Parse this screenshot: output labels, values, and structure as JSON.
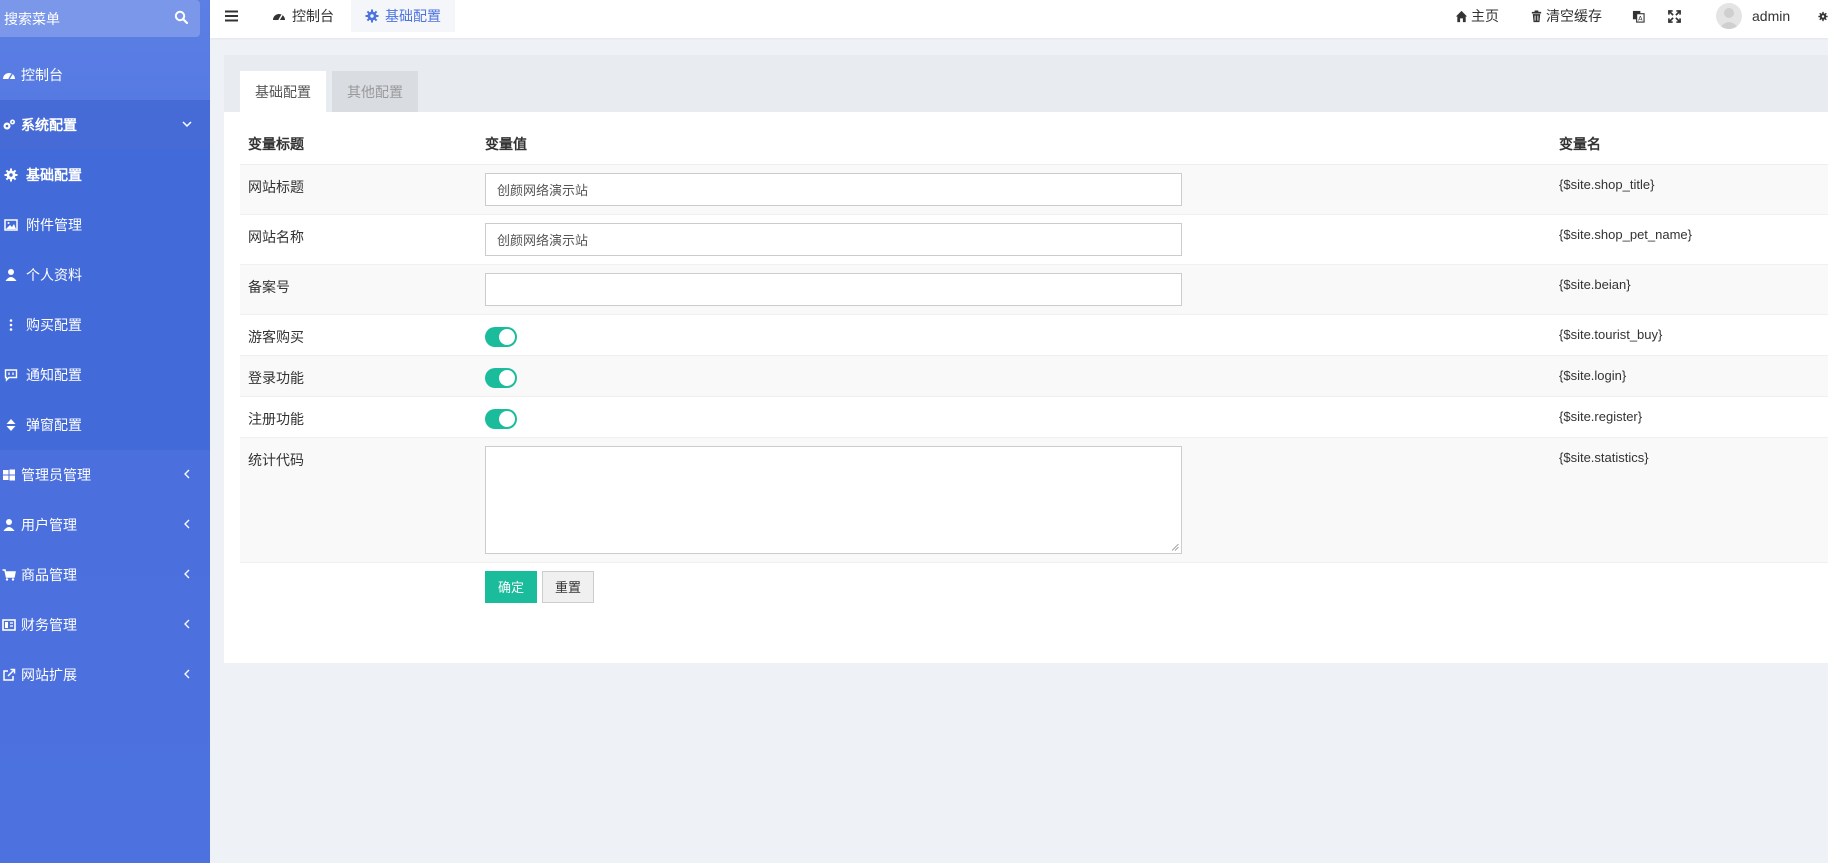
{
  "sidebar": {
    "search_placeholder": "搜索菜单",
    "items": [
      {
        "label": "控制台"
      },
      {
        "label": "系统配置"
      },
      {
        "label": "管理员管理"
      },
      {
        "label": "用户管理"
      },
      {
        "label": "商品管理"
      },
      {
        "label": "财务管理"
      },
      {
        "label": "网站扩展"
      }
    ],
    "submenu": [
      {
        "label": "基础配置"
      },
      {
        "label": "附件管理"
      },
      {
        "label": "个人资料"
      },
      {
        "label": "购买配置"
      },
      {
        "label": "通知配置"
      },
      {
        "label": "弹窗配置"
      }
    ]
  },
  "topnav": {
    "tabs": [
      {
        "label": "控制台"
      },
      {
        "label": "基础配置"
      }
    ],
    "home": "主页",
    "clear_cache": "清空缓存",
    "user": "admin"
  },
  "panel": {
    "tabs": [
      {
        "label": "基础配置"
      },
      {
        "label": "其他配置"
      }
    ],
    "columns": {
      "title": "变量标题",
      "value": "变量值",
      "name": "变量名"
    },
    "rows": {
      "site_title": {
        "label": "网站标题",
        "value": "创颜网络演示站",
        "var": "{$site.shop_title}"
      },
      "site_name": {
        "label": "网站名称",
        "value": "创颜网络演示站",
        "var": "{$site.shop_pet_name}"
      },
      "beian": {
        "label": "备案号",
        "value": "",
        "var": "{$site.beian}"
      },
      "tourist_buy": {
        "label": "游客购买",
        "var": "{$site.tourist_buy}"
      },
      "login": {
        "label": "登录功能",
        "var": "{$site.login}"
      },
      "register": {
        "label": "注册功能",
        "var": "{$site.register}"
      },
      "statistics": {
        "label": "统计代码",
        "value": "",
        "var": "{$site.statistics}"
      }
    },
    "buttons": {
      "confirm": "确定",
      "reset": "重置"
    }
  },
  "colors": {
    "sidebar": "#4e73df",
    "accent": "#1abc9c",
    "active_tab_text": "#4e73df"
  }
}
